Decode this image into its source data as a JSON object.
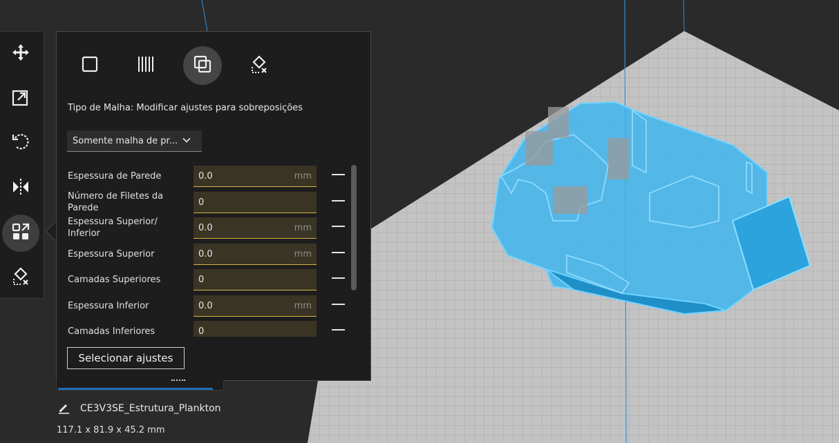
{
  "tool_rail": {
    "tools": [
      {
        "icon": "move-icon"
      },
      {
        "icon": "scale-icon"
      },
      {
        "icon": "rotate-icon"
      },
      {
        "icon": "mirror-icon"
      },
      {
        "icon": "per-model-settings-icon",
        "active": true
      },
      {
        "icon": "support-blocker-icon"
      }
    ]
  },
  "panel": {
    "mesh_types": [
      {
        "icon": "normal-model-icon"
      },
      {
        "icon": "infill-mesh-icon"
      },
      {
        "icon": "overlap-mesh-icon",
        "active": true
      },
      {
        "icon": "support-blocker-mesh-icon"
      }
    ],
    "mesh_type_label": "Tipo de Malha: Modificar ajustes para sobreposições",
    "dropdown_value": "Somente malha de pr...",
    "settings": [
      {
        "label": "Espessura de Parede",
        "value": "0.0",
        "unit": "mm"
      },
      {
        "label": "Número de Filetes da Parede",
        "value": "0",
        "unit": ""
      },
      {
        "label": "Espessura Superior/ Inferior",
        "value": "0.0",
        "unit": "mm"
      },
      {
        "label": "Espessura Superior",
        "value": "0.0",
        "unit": "mm"
      },
      {
        "label": "Camadas Superiores",
        "value": "0",
        "unit": ""
      },
      {
        "label": "Espessura Inferior",
        "value": "0.0",
        "unit": "mm"
      },
      {
        "label": "Camadas Inferiores",
        "value": "0",
        "unit": ""
      }
    ],
    "select_settings_label": "Selecionar ajustes"
  },
  "object": {
    "name": "CE3V3SE_Estrutura_Plankton",
    "dimensions": "117.1 x 81.9 x 45.2 mm"
  },
  "colors": {
    "model_blue": "#3ab4ef",
    "field_accent": "#d8b446",
    "build_plate": "#c6c6c6"
  }
}
